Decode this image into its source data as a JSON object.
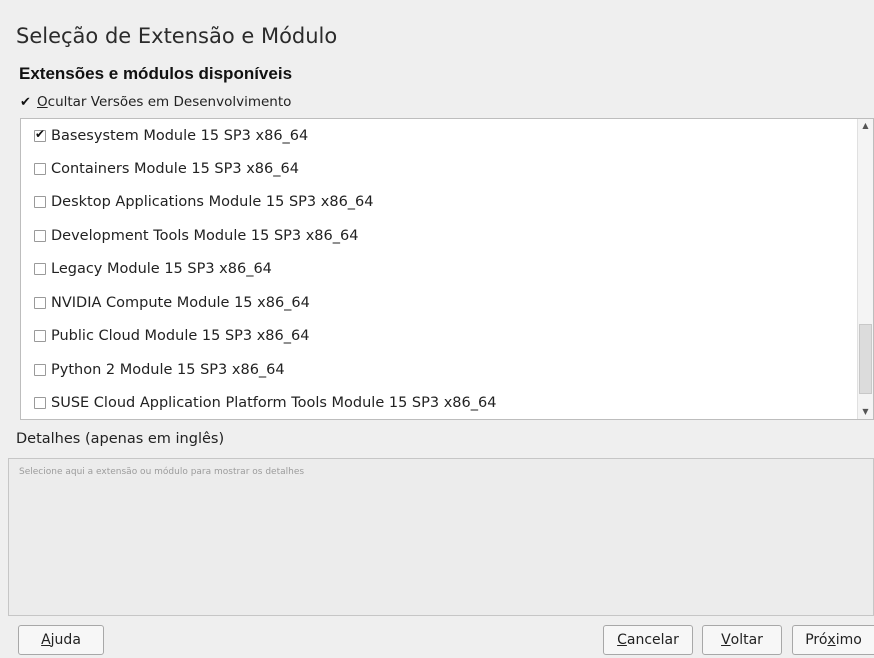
{
  "window": {
    "title": "Seleção de Extensão e Módulo",
    "subtitle": "Extensões e módulos disponíveis"
  },
  "hide_dev": {
    "checked": true,
    "check_glyph": "✔",
    "accel": "O",
    "label_rest": "cultar Versões em Desenvolvimento"
  },
  "modules": [
    {
      "label": "Basesystem Module 15 SP3 x86_64",
      "checked": true
    },
    {
      "label": "Containers Module 15 SP3 x86_64",
      "checked": false
    },
    {
      "label": "Desktop Applications Module 15 SP3 x86_64",
      "checked": false
    },
    {
      "label": "Development Tools Module 15 SP3 x86_64",
      "checked": false
    },
    {
      "label": "Legacy Module 15 SP3 x86_64",
      "checked": false
    },
    {
      "label": "NVIDIA Compute Module 15 x86_64",
      "checked": false
    },
    {
      "label": "Public Cloud Module 15 SP3 x86_64",
      "checked": false
    },
    {
      "label": "Python 2 Module 15 SP3 x86_64",
      "checked": false
    },
    {
      "label": "SUSE Cloud Application Platform Tools Module 15 SP3 x86_64",
      "checked": false
    }
  ],
  "scrollbar": {
    "up_glyph": "▲",
    "down_glyph": "▼"
  },
  "details": {
    "label": "Detalhes (apenas em inglês)",
    "placeholder": "Selecione aqui a extensão ou módulo para mostrar os detalhes"
  },
  "buttons": {
    "help": {
      "accel": "A",
      "rest": "juda"
    },
    "cancel": {
      "accel": "C",
      "rest": "ancelar"
    },
    "back": {
      "accel": "V",
      "rest": "oltar"
    },
    "next": {
      "pre": "Pró",
      "accel": "x",
      "rest": "imo"
    }
  }
}
